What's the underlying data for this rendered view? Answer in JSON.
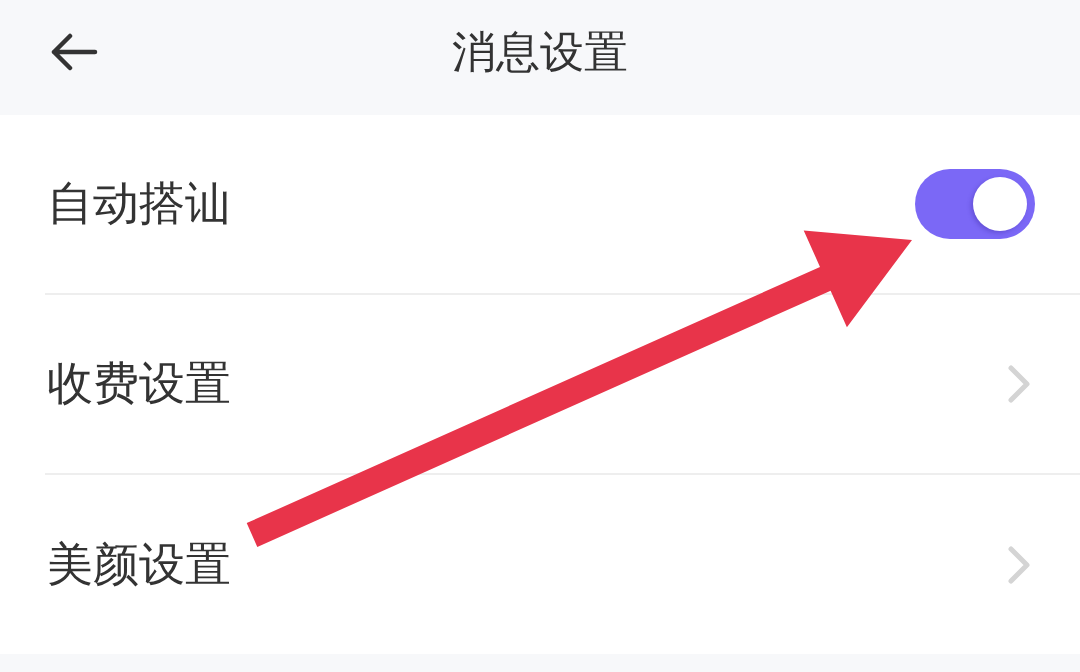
{
  "header": {
    "title": "消息设置"
  },
  "settings": [
    {
      "label": "自动搭讪",
      "kind": "toggle",
      "on": true
    },
    {
      "label": "收费设置",
      "kind": "link"
    },
    {
      "label": "美颜设置",
      "kind": "link"
    }
  ]
}
